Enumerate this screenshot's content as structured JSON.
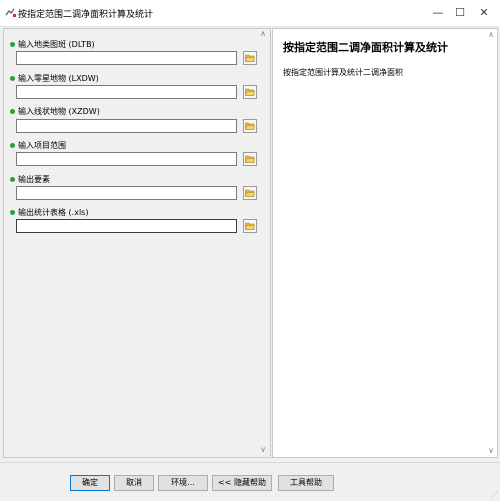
{
  "window": {
    "title": "按指定范围二调净面积计算及统计",
    "minimize_glyph": "—",
    "maximize_glyph": "☐",
    "close_glyph": "✕"
  },
  "params": [
    {
      "label": "输入地类图斑 (DLTB)",
      "value": "",
      "required": true
    },
    {
      "label": "输入零星地物 (LXDW)",
      "value": "",
      "required": true
    },
    {
      "label": "输入线状地物 (XZDW)",
      "value": "",
      "required": true
    },
    {
      "label": "输入项目范围",
      "value": "",
      "required": true
    },
    {
      "label": "输出要素",
      "value": "",
      "required": true
    },
    {
      "label": "输出统计表格 (.xls)",
      "value": "",
      "required": true
    }
  ],
  "help": {
    "title": "按指定范围二调净面积计算及统计",
    "description": "按指定范围计算及统计二调净面积"
  },
  "buttons": {
    "ok": "确定",
    "cancel": "取消",
    "environments": "环境...",
    "hide_help": "<< 隐藏帮助",
    "tool_help": "工具帮助"
  },
  "icons": {
    "app": "toolbox-script-icon",
    "browse": "folder-open-icon"
  },
  "colors": {
    "required_dot": "#2ea02e",
    "folder": "#e8b53a",
    "default_button_border": "#0078d7"
  }
}
